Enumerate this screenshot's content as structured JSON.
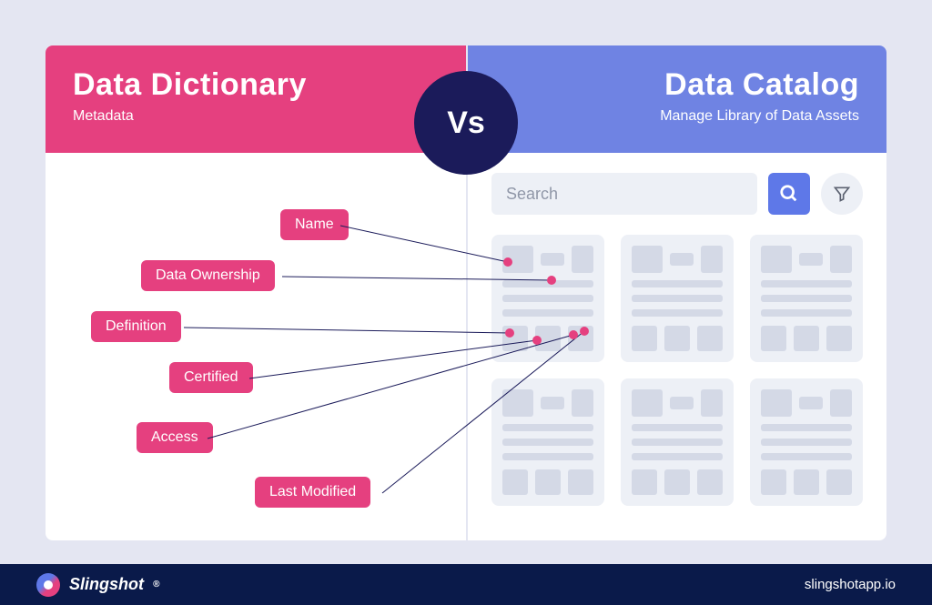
{
  "left": {
    "title": "Data Dictionary",
    "subtitle": "Metadata"
  },
  "right": {
    "title": "Data Catalog",
    "subtitle": "Manage Library of Data Assets"
  },
  "vs": "Vs",
  "tags": {
    "name": "Name",
    "ownership": "Data Ownership",
    "definition": "Definition",
    "certified": "Certified",
    "access": "Access",
    "lastModified": "Last Modified"
  },
  "search": {
    "placeholder": "Search"
  },
  "footer": {
    "brand": "Slingshot",
    "url": "slingshotapp.io"
  }
}
